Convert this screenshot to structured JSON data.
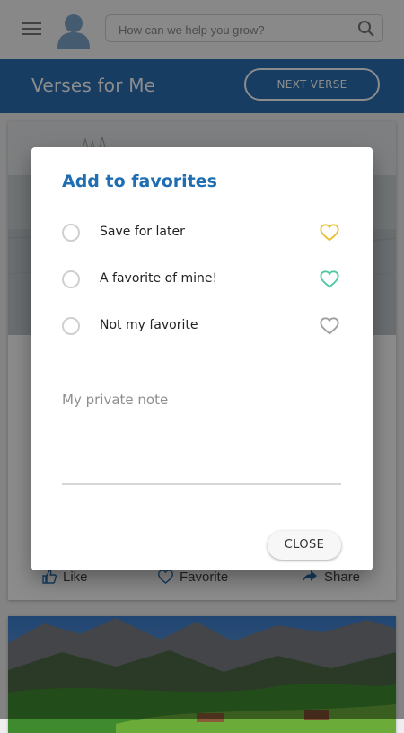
{
  "search": {
    "placeholder": "How can we help you grow?"
  },
  "header": {
    "title": "Verses for Me",
    "next_button": "NEXT VERSE"
  },
  "card": {
    "actions": {
      "like": "Like",
      "favorite": "Favorite",
      "share": "Share"
    }
  },
  "dialog": {
    "title": "Add to favorites",
    "options": [
      {
        "label": "Save for later",
        "heart_color": "#e8c234"
      },
      {
        "label": "A favorite of mine!",
        "heart_color": "#4fc9a4"
      },
      {
        "label": "Not my favorite",
        "heart_color": "#9e9e9e"
      }
    ],
    "note_placeholder": "My private note",
    "close_label": "CLOSE"
  },
  "colors": {
    "header_blue": "#2a6fb3",
    "title_blue": "#1f6db2"
  }
}
